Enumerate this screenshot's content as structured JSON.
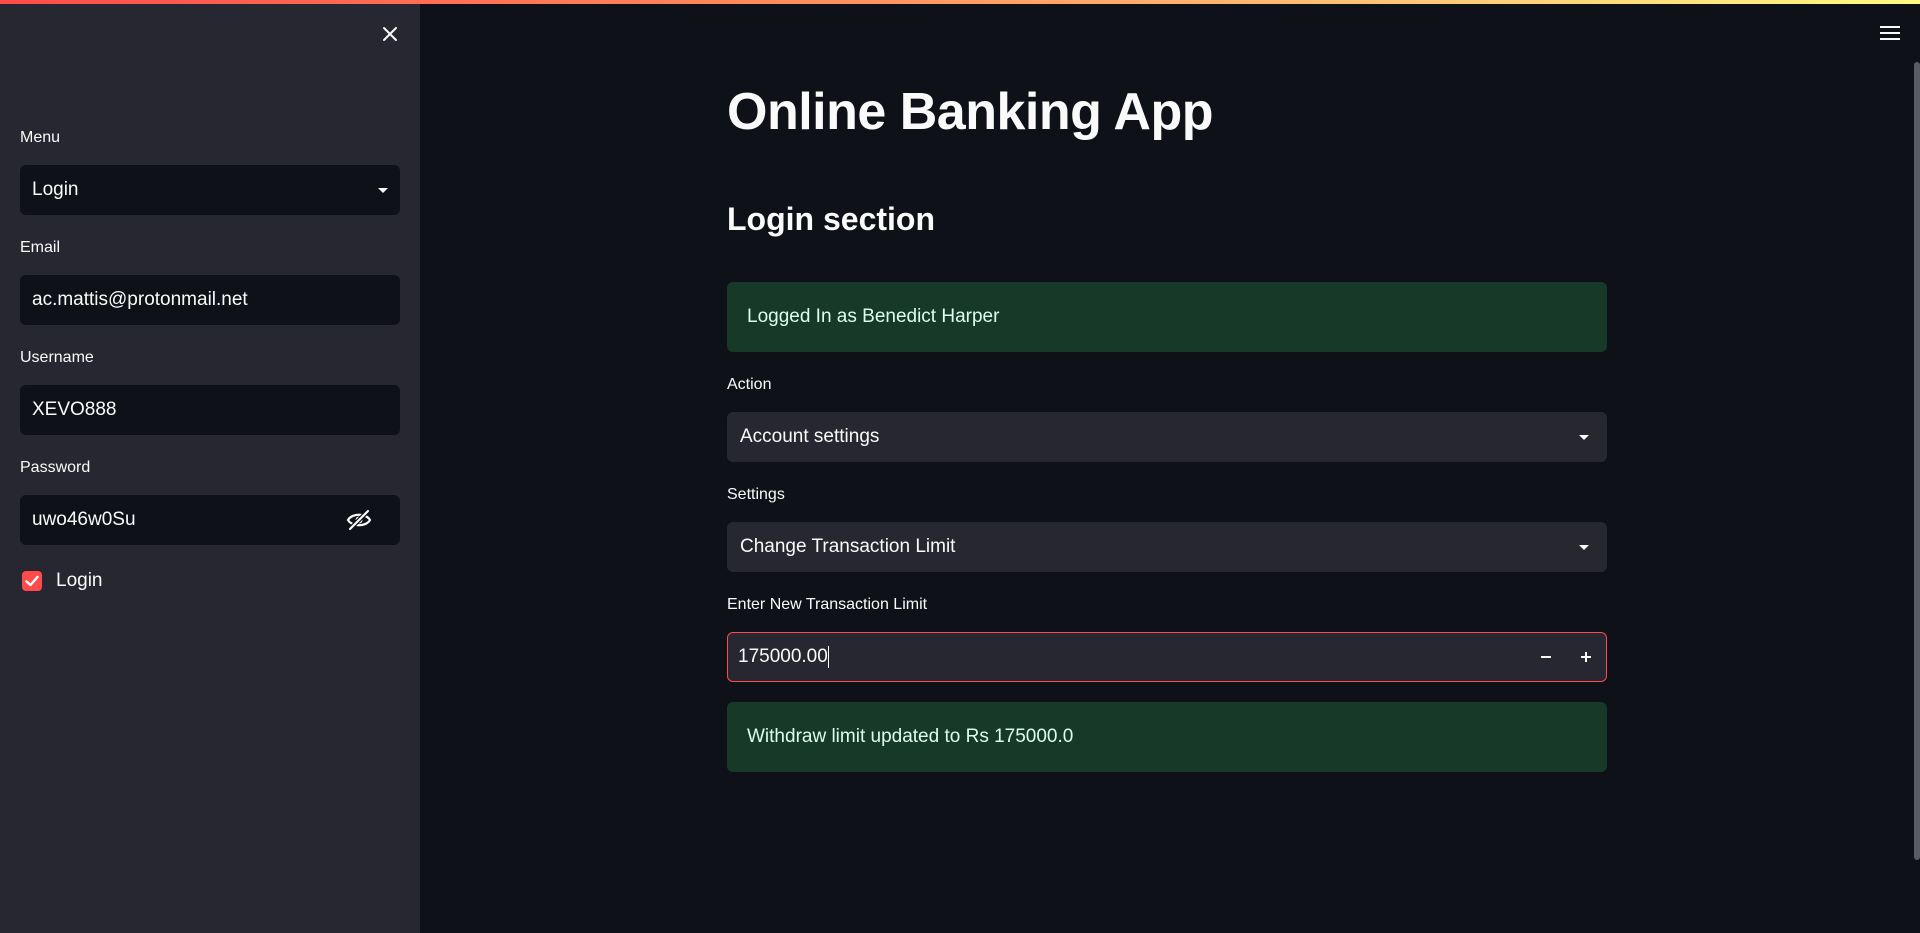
{
  "app": {
    "title": "Online Banking App",
    "section_title": "Login section"
  },
  "sidebar": {
    "menu": {
      "label": "Menu",
      "value": "Login"
    },
    "email": {
      "label": "Email",
      "value": "ac.mattis@protonmail.net"
    },
    "username": {
      "label": "Username",
      "value": "XEVO888"
    },
    "password": {
      "label": "Password",
      "value": "uwo46w0Su"
    },
    "login_checkbox": {
      "label": "Login",
      "checked": true
    }
  },
  "main": {
    "login_alert": "Logged In as Benedict Harper",
    "action": {
      "label": "Action",
      "value": "Account settings"
    },
    "settings": {
      "label": "Settings",
      "value": "Change Transaction Limit"
    },
    "limit_input": {
      "label": "Enter New Transaction Limit",
      "value": "175000.00"
    },
    "update_alert": "Withdraw limit updated to Rs 175000.0"
  },
  "icons": {
    "close": "close-icon",
    "menu": "hamburger-menu-icon",
    "dropdown": "chevron-down-icon",
    "password_toggle": "eye-slash-icon",
    "checkbox": "checkmark-icon",
    "minus": "minus-icon",
    "plus": "plus-icon"
  },
  "colors": {
    "background": "#0e1117",
    "sidebar": "#262730",
    "accent": "#ff4b4b",
    "success_bg": "#173928",
    "success_text": "#dffde9"
  }
}
